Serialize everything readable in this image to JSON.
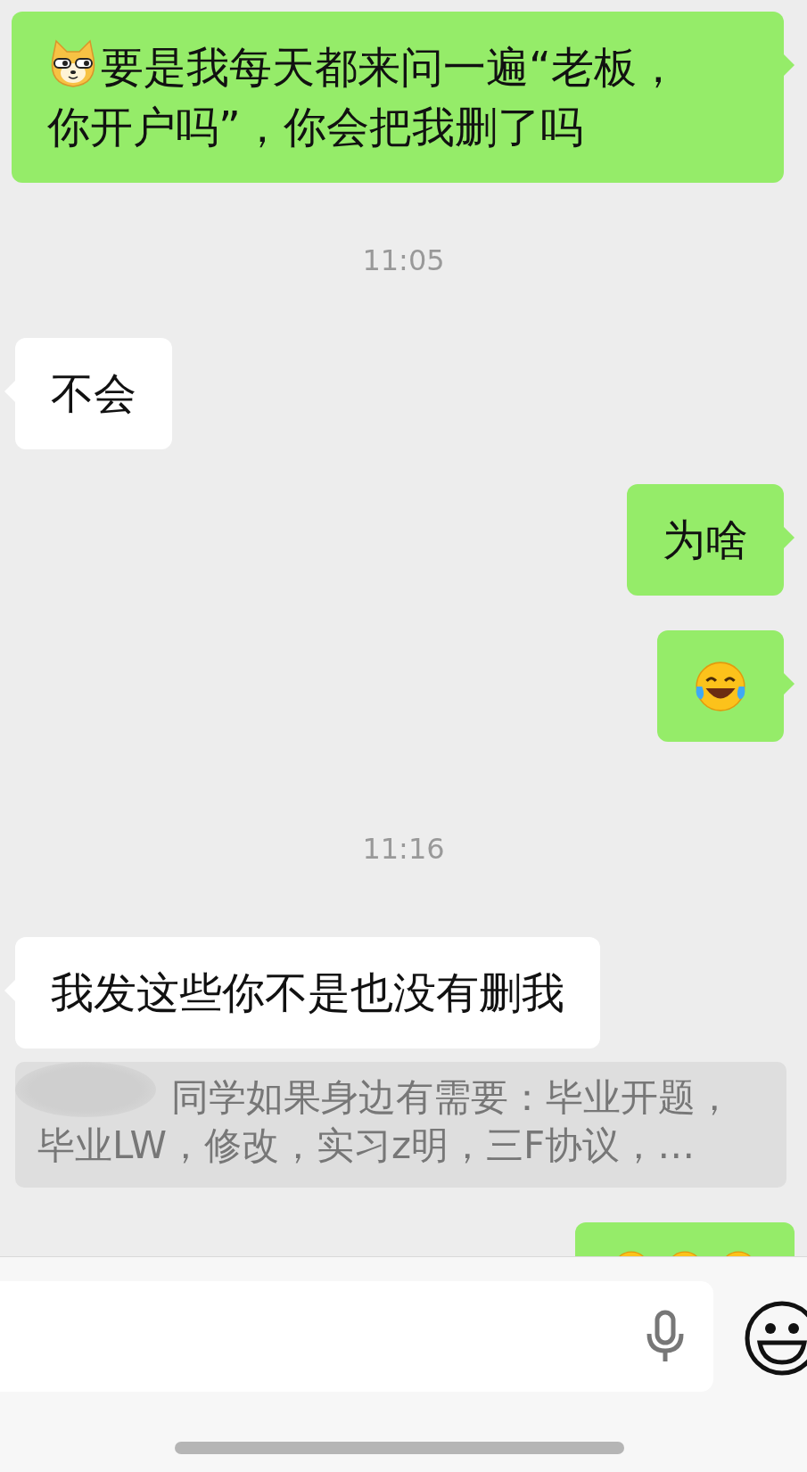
{
  "messages": [
    {
      "kind": "dogsent",
      "text": "要是我每天都来问一遍“老板，你开户吗”，你会把我删了吗"
    },
    {
      "kind": "time",
      "text": "11:05"
    },
    {
      "kind": "received",
      "text": "不会"
    },
    {
      "kind": "sent",
      "text": "为啥"
    },
    {
      "kind": "laugh"
    },
    {
      "kind": "time",
      "text": "11:16"
    },
    {
      "kind": "received",
      "text": "我发这些你不是也没有删我"
    },
    {
      "kind": "quote",
      "text": "同学如果身边有需要：毕业开题，毕业LW，修改，实习z明，三F协议，…"
    },
    {
      "kind": "laughs"
    }
  ]
}
